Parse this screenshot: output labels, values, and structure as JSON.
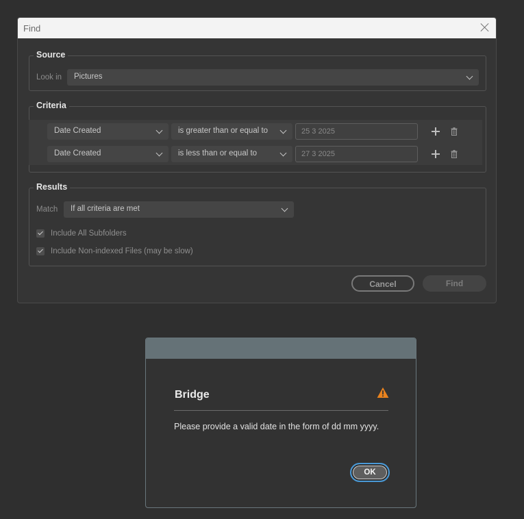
{
  "find_dialog": {
    "title": "Find",
    "source": {
      "legend": "Source",
      "look_in_label": "Look in",
      "look_in_value": "Pictures"
    },
    "criteria": {
      "legend": "Criteria",
      "rows": [
        {
          "field": "Date Created",
          "operator": "is greater than or equal to",
          "value": "25 3 2025"
        },
        {
          "field": "Date Created",
          "operator": "is less than or equal to",
          "value": "27 3 2025"
        }
      ]
    },
    "results": {
      "legend": "Results",
      "match_label": "Match",
      "match_value": "If all criteria are met",
      "include_subfolders_label": "Include All Subfolders",
      "include_subfolders_checked": true,
      "include_nonindexed_label": "Include Non-indexed Files (may be slow)",
      "include_nonindexed_checked": true
    },
    "buttons": {
      "cancel": "Cancel",
      "find": "Find"
    }
  },
  "alert_dialog": {
    "title": "Bridge",
    "icon": "warning-icon",
    "icon_color": "#e8821e",
    "message": "Please provide a valid date in the form of  dd mm yyyy.",
    "ok_label": "OK"
  }
}
